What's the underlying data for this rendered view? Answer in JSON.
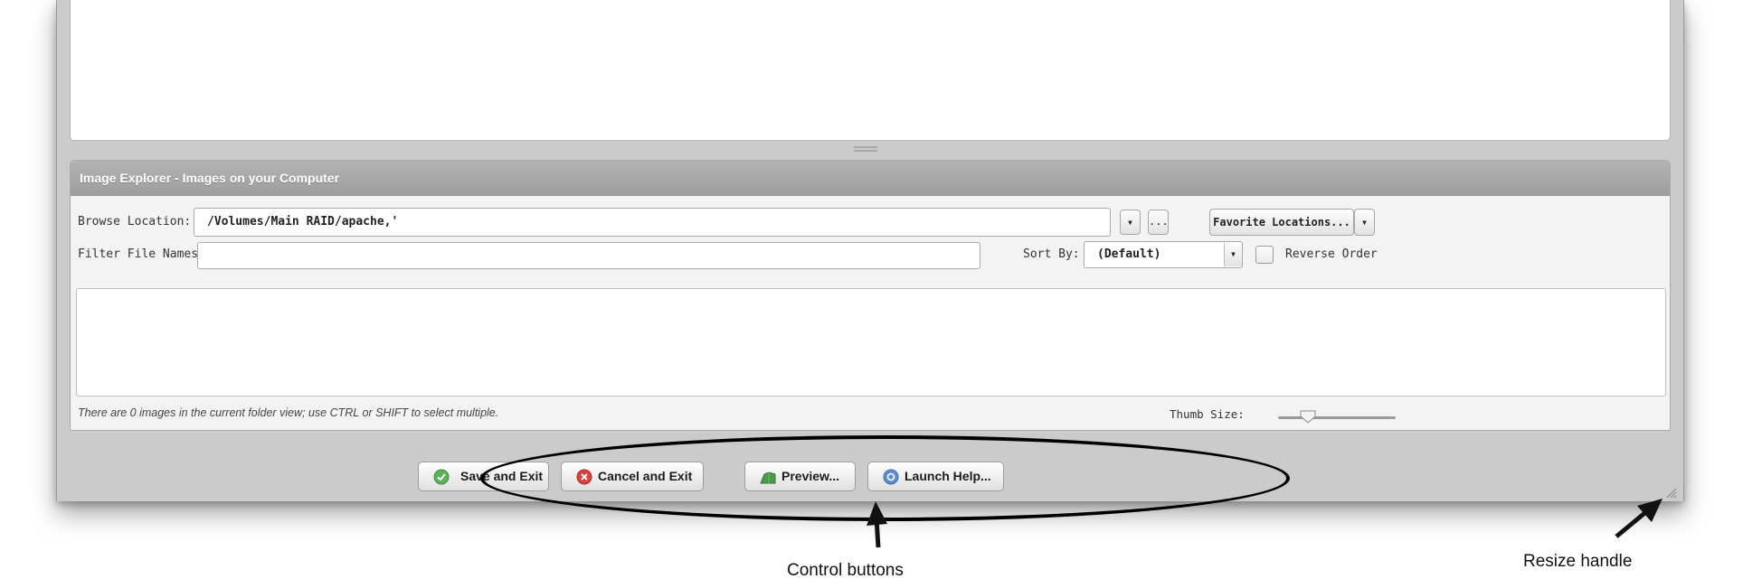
{
  "explorer": {
    "title": "Image Explorer - Images on your Computer",
    "browse_label": "Browse Location:",
    "browse_value": "/Volumes/Main RAID/apache,'",
    "browse_dropdown_glyph": "▾",
    "browse_more_label": "...",
    "favorites_label": "Favorite Locations...",
    "favorites_dropdown_glyph": "▾",
    "filter_label": "Filter File Names:",
    "filter_value": "",
    "sort_label": "Sort By:",
    "sort_value": "(Default)",
    "sort_dropdown_glyph": "▾",
    "reverse_label": "Reverse Order",
    "reverse_checked": false,
    "status_text": "There are 0 images in the current folder view; use CTRL or SHIFT to select multiple.",
    "thumb_size_label": "Thumb Size:",
    "thumb_size_level": 0.25
  },
  "footer": {
    "save_label": "Save and Exit",
    "cancel_label": "Cancel and Exit",
    "preview_label": "Preview...",
    "help_label": "Launch Help..."
  },
  "annotations": {
    "control_buttons": "Control buttons",
    "resize_handle": "Resize handle"
  },
  "icons": {
    "save": "check-circle-icon",
    "cancel": "x-circle-icon",
    "preview": "preview-image-icon",
    "help": "help-circle-icon"
  },
  "colors": {
    "save_green": "#5cb25a",
    "cancel_red": "#d9423a",
    "help_blue": "#5b8fcf",
    "header_gray": "#a6a6a6"
  }
}
